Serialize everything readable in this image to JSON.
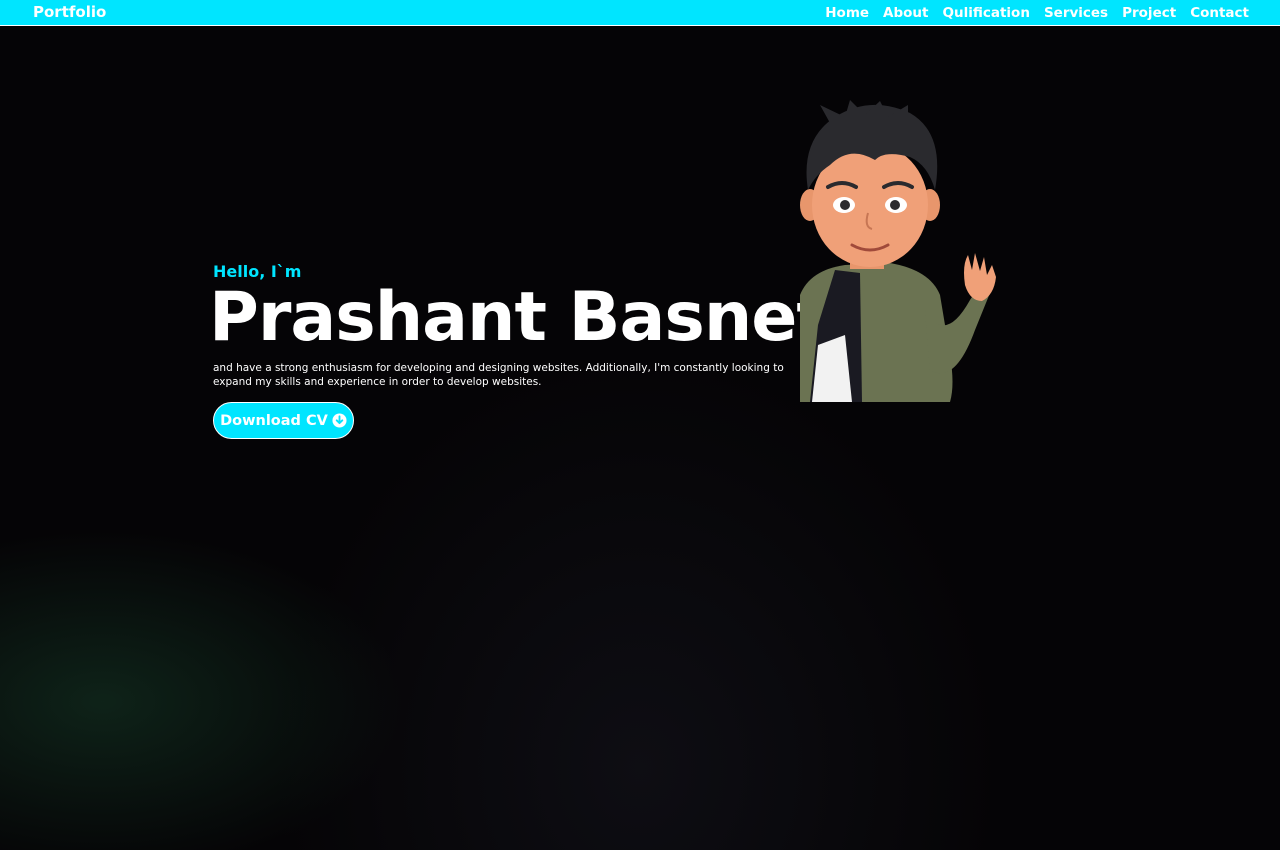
{
  "nav": {
    "brand": "Portfolio",
    "links": [
      "Home",
      "About",
      "Qulification",
      "Services",
      "Project",
      "Contact"
    ]
  },
  "hero": {
    "greeting": "Hello, I`m",
    "name": "Prashant Basnet",
    "description": "and have a strong enthusiasm for developing and designing websites. Additionally, I'm constantly looking to expand my skills and experience in order to develop websites.",
    "cta_label": "Download CV"
  },
  "icons": {
    "cta_icon": "download-icon",
    "avatar": "waving-cartoon-avatar"
  },
  "colors": {
    "accent": "#00e5ff",
    "background": "#050406",
    "text": "#ffffff"
  }
}
